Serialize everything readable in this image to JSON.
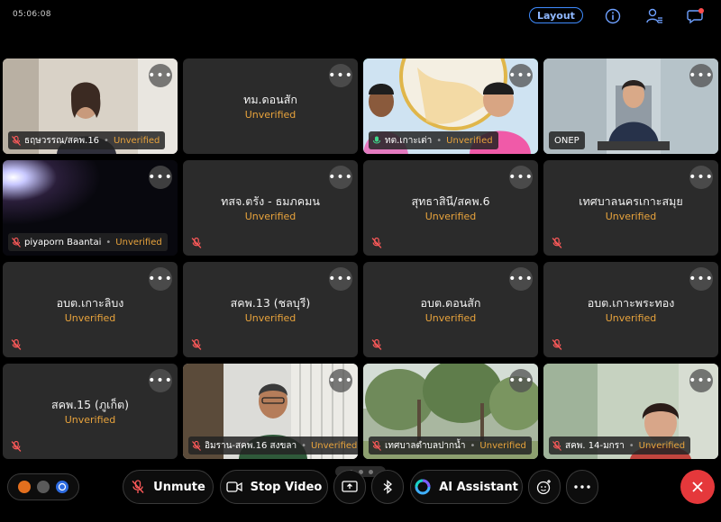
{
  "top": {
    "time": "05:06:08",
    "layout_label": "Layout",
    "icons": [
      "info-icon",
      "participants-icon",
      "chat-icon"
    ],
    "notification_color": "#ff4d4d"
  },
  "tiles": [
    {
      "name": "ธฤษวรรณ/สคพ.16",
      "status": "Unverified",
      "video": true
    },
    {
      "name": "ทม.ดอนสัก",
      "status": "Unverified",
      "video": false
    },
    {
      "name": "ทต.เกาะเต่า",
      "status": "Unverified",
      "video": true,
      "speaking": true
    },
    {
      "name": "ONEP",
      "video": true
    },
    {
      "name": "piyaporn Baantai",
      "status": "Unverified",
      "video": true
    },
    {
      "name": "ทสจ.ตรัง - ธมภคมน",
      "status": "Unverified",
      "video": false
    },
    {
      "name": "สุทธาสินี/สคพ.6",
      "status": "Unverified",
      "video": false
    },
    {
      "name": "เทศบาลนครเกาะสมุย",
      "status": "Unverified",
      "video": false
    },
    {
      "name": "อบต.เกาะลิบง",
      "status": "Unverified",
      "video": false
    },
    {
      "name": "สคพ.13 (ชลบุรี)",
      "status": "Unverified",
      "video": false
    },
    {
      "name": "อบต.ดอนสัก",
      "status": "Unverified",
      "video": false
    },
    {
      "name": "อบต.เกาะพระทอง",
      "status": "Unverified",
      "video": false
    },
    {
      "name": "สคพ.15 (ภูเก็ต)",
      "status": "Unverified",
      "video": false
    },
    {
      "name": "อิมราน-สคพ.16 สงขลา",
      "status": "Unverified",
      "video": true
    },
    {
      "name": "เทศบาลตำบลปากน้ำ",
      "status": "Unverified",
      "video": true
    },
    {
      "name": "สคพ. 14-มกรา",
      "status": "Unverified",
      "video": true
    }
  ],
  "toolbar": {
    "unmute": "Unmute",
    "stop_video": "Stop Video",
    "ai_assistant": "AI Assistant",
    "end_color": "#e5383b"
  },
  "pager": {
    "pages": 3,
    "current": 1
  }
}
